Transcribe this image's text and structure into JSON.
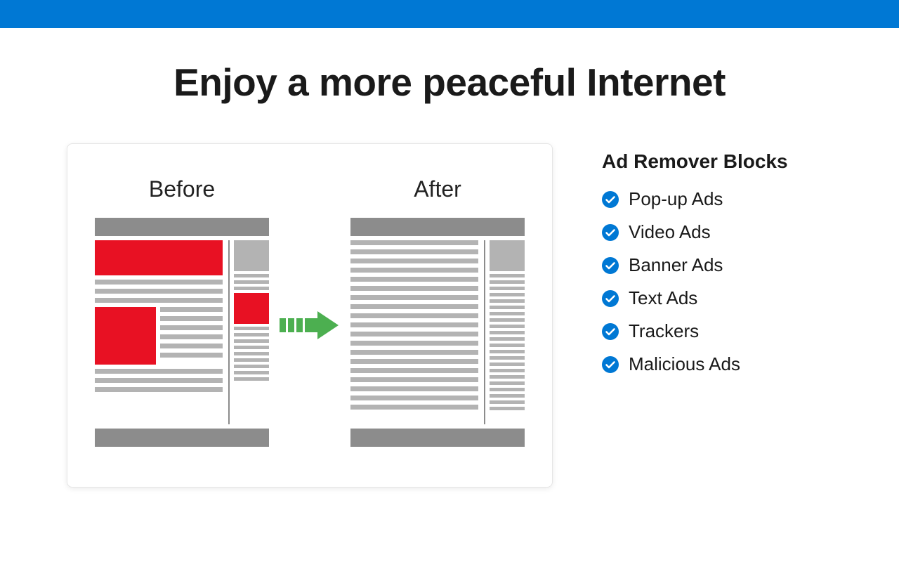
{
  "heading": "Enjoy a more peaceful Internet",
  "compare": {
    "before_label": "Before",
    "after_label": "After"
  },
  "features": {
    "title": "Ad Remover Blocks",
    "items": [
      "Pop-up Ads",
      "Video Ads",
      "Banner Ads",
      "Text Ads",
      "Trackers",
      "Malicious Ads"
    ]
  },
  "colors": {
    "accent": "#0078d4",
    "ad_red": "#e81123",
    "arrow_green": "#4caf50",
    "gray_dark": "#8c8c8c",
    "gray_light": "#b3b3b3"
  },
  "icons": {
    "check": "check-circle-icon",
    "arrow": "arrow-right-icon"
  }
}
